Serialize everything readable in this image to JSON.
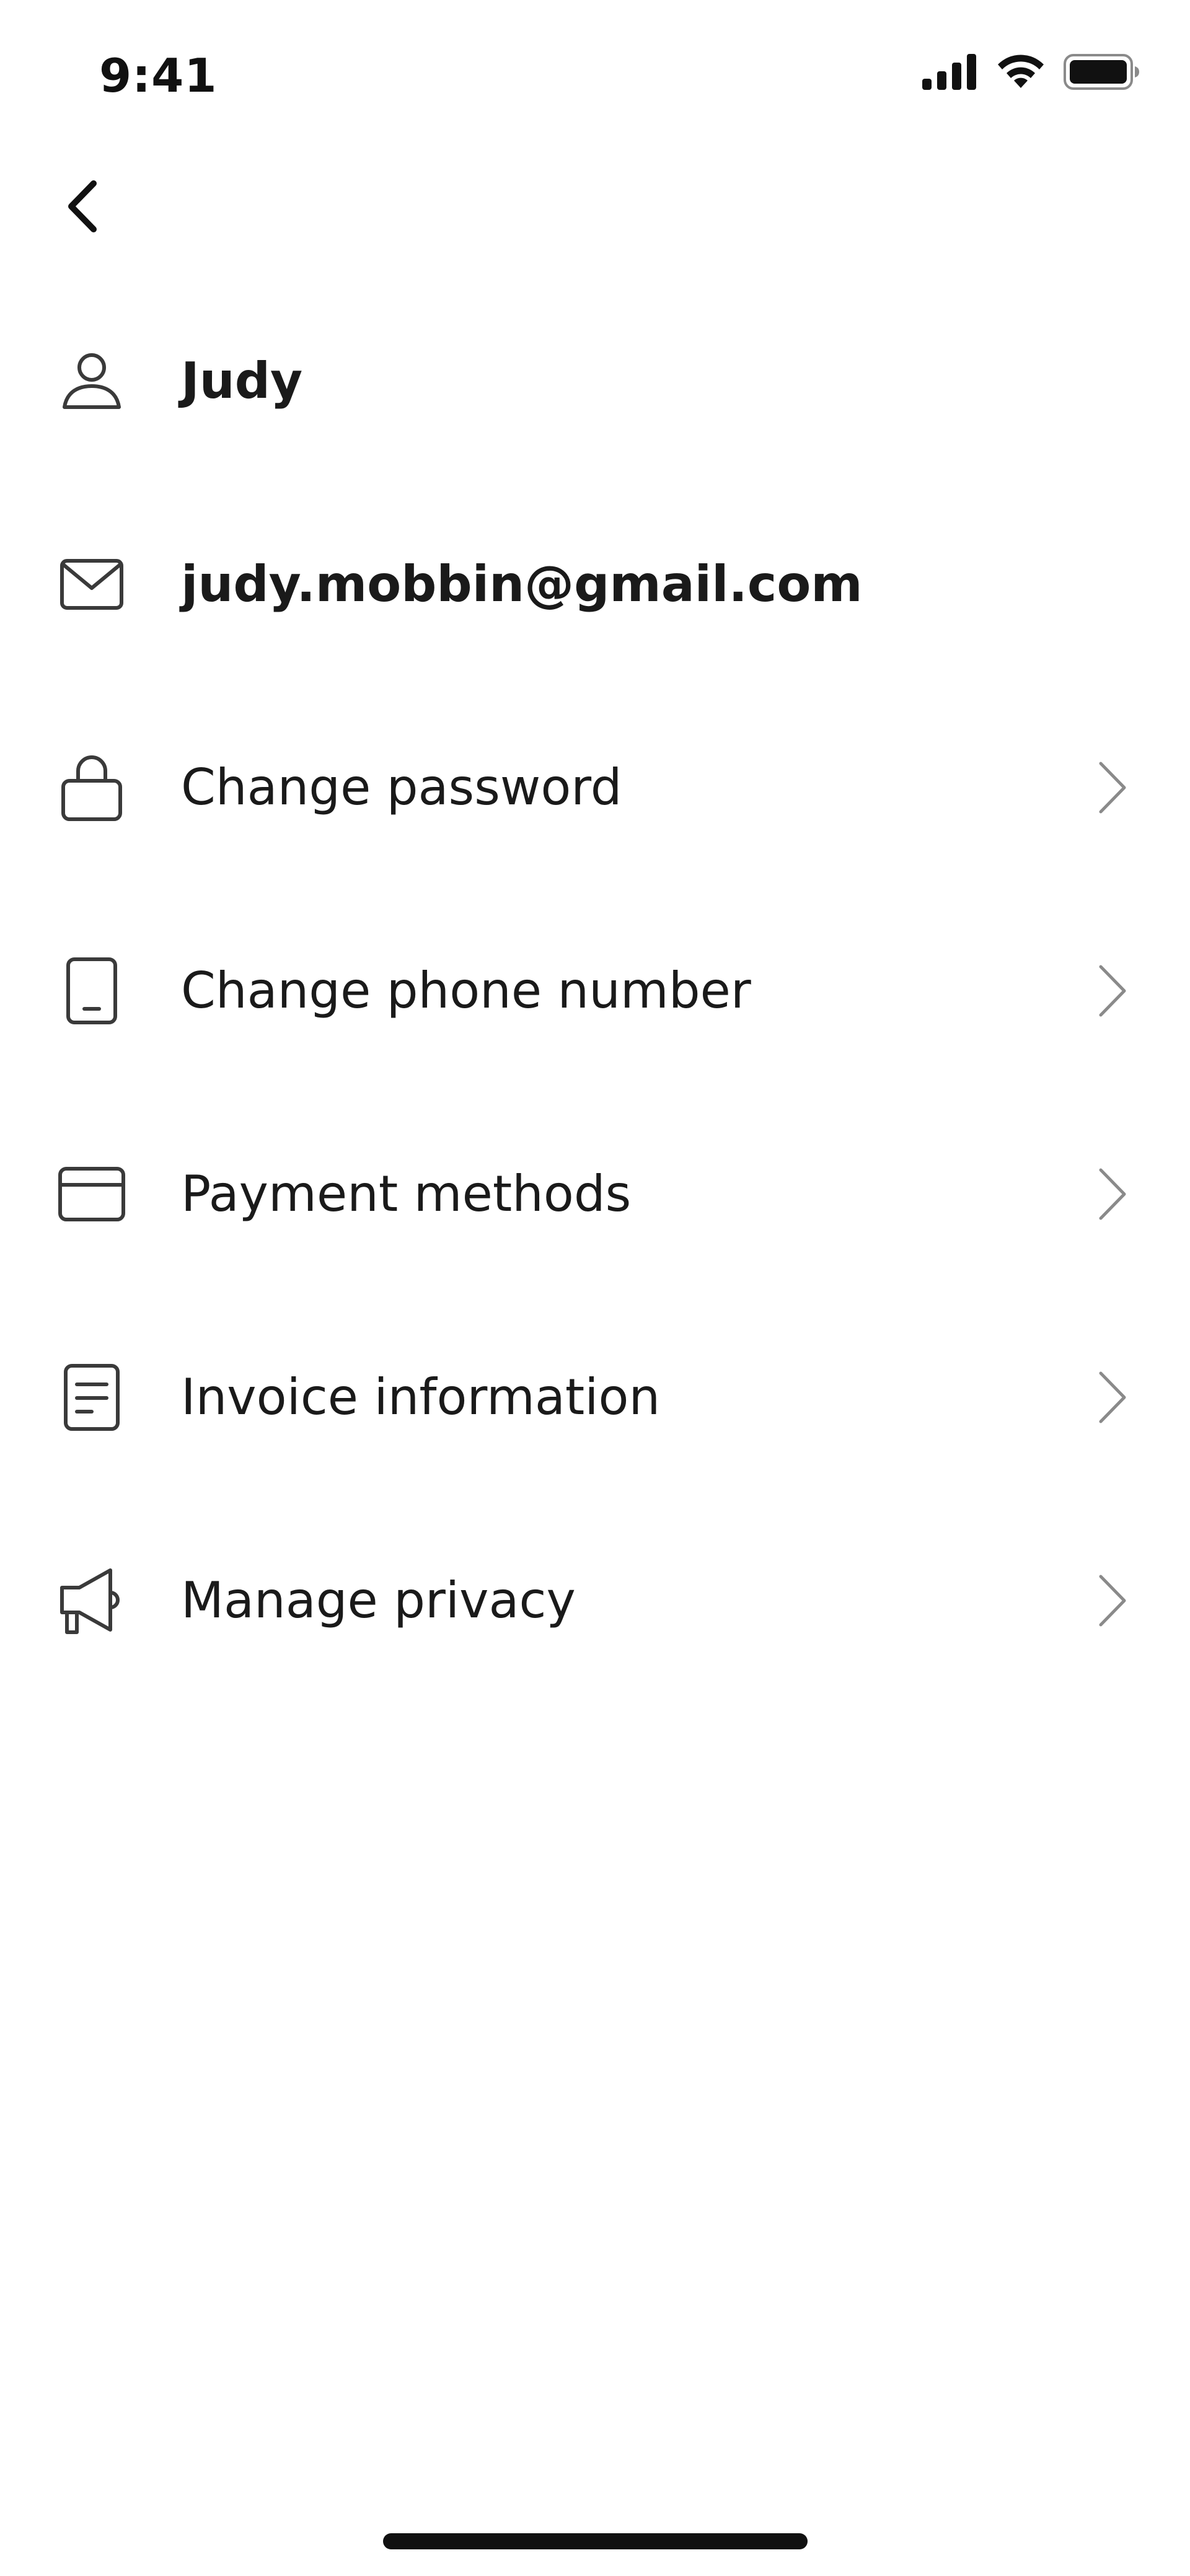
{
  "status_bar": {
    "time": "9:41",
    "icons": [
      "cellular-signal-icon",
      "wifi-icon",
      "battery-icon"
    ]
  },
  "navigation": {
    "back_icon": "chevron-left-icon"
  },
  "profile": {
    "name": "Judy",
    "name_icon": "person-icon",
    "email": "judy.mobbin@gmail.com",
    "email_icon": "envelope-icon"
  },
  "menu": {
    "items": [
      {
        "label": "Change password",
        "icon": "lock-icon"
      },
      {
        "label": "Change phone number",
        "icon": "phone-icon"
      },
      {
        "label": "Payment methods",
        "icon": "credit-card-icon"
      },
      {
        "label": "Invoice information",
        "icon": "document-icon"
      },
      {
        "label": "Manage privacy",
        "icon": "megaphone-icon"
      }
    ],
    "chevron_icon": "chevron-right-icon"
  },
  "colors": {
    "text": "#1a1a1a",
    "icon": "#3a3a3a",
    "chevron": "#8a8a8a",
    "background": "#ffffff"
  }
}
